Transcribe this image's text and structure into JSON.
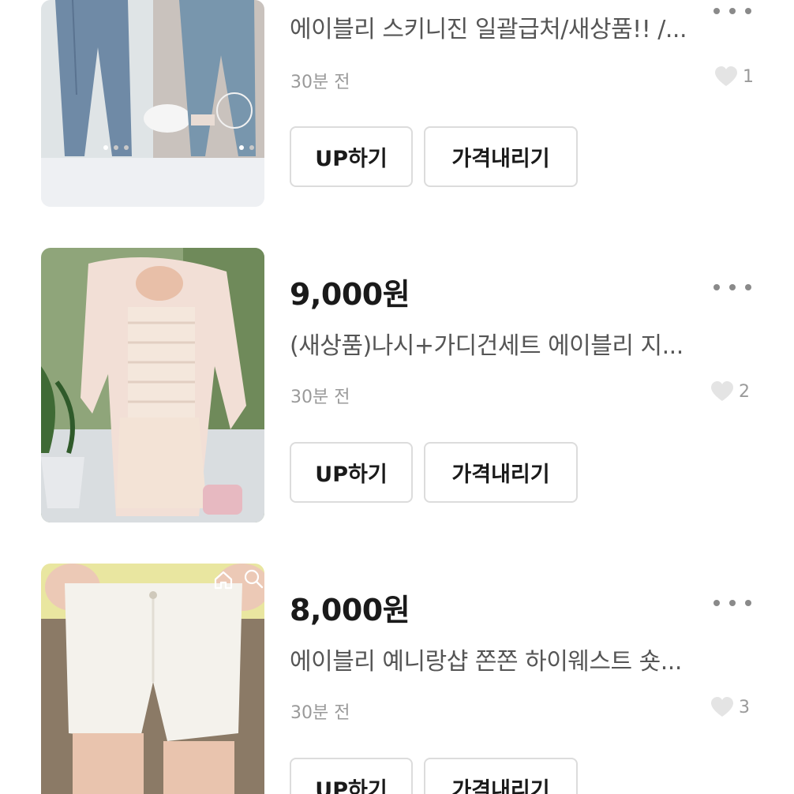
{
  "listings": [
    {
      "price": "",
      "title": "에이블리 스키니진 일괄급처/새상품!! /...",
      "time": "30분 전",
      "likes": "1",
      "up_label": "UP하기",
      "price_down_label": "가격내리기"
    },
    {
      "price": "9,000원",
      "title": "(새상품)나시+가디건세트 에이블리 지...",
      "time": "30분 전",
      "likes": "2",
      "up_label": "UP하기",
      "price_down_label": "가격내리기"
    },
    {
      "price": "8,000원",
      "title": "에이블리 예니랑샵 쫀쫀 하이웨스트 숏...",
      "time": "30분 전",
      "likes": "3",
      "up_label": "UP하기",
      "price_down_label": "가격내리기"
    }
  ],
  "icons": {
    "more": "more-dots-icon",
    "like": "heart-icon",
    "home": "home-icon",
    "search": "search-icon"
  },
  "colors": {
    "text_primary": "#1a1a1a",
    "text_secondary": "#555555",
    "text_muted": "#9a9a9a",
    "button_border": "#dcdcdc",
    "heart": "#e4e4e4"
  }
}
